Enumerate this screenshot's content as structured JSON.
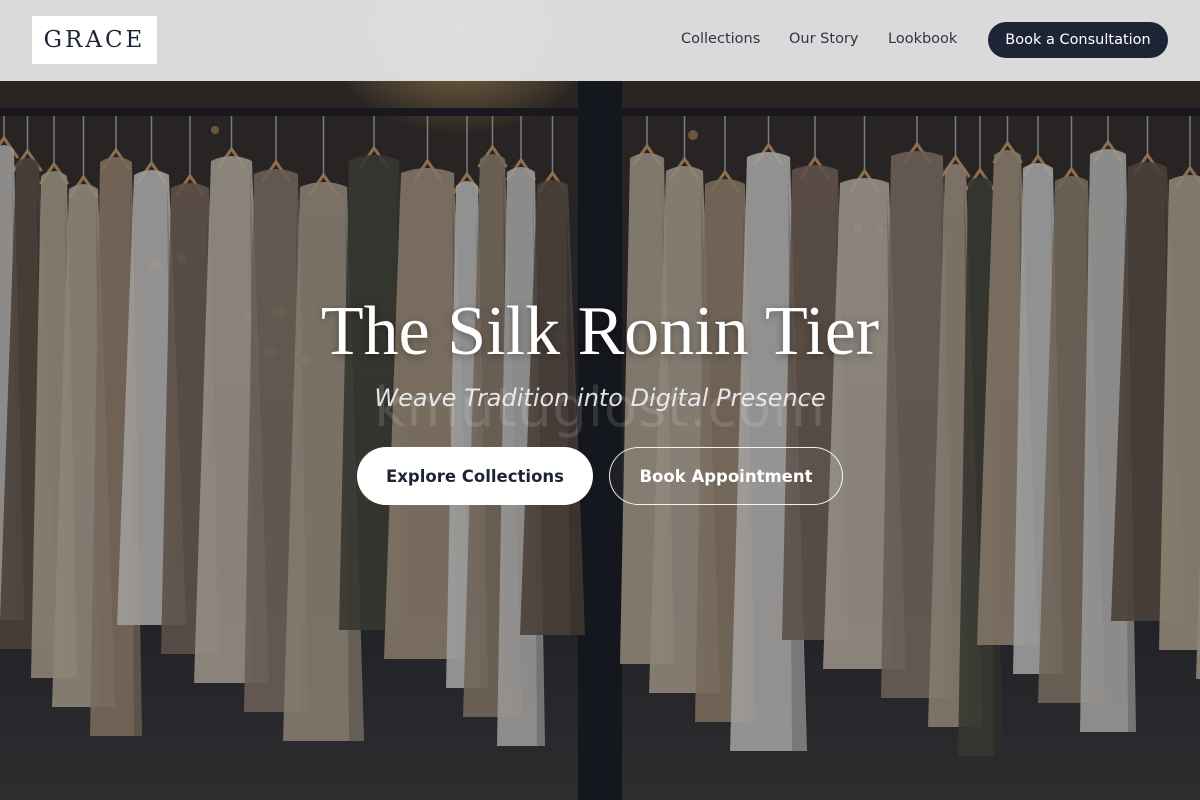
{
  "header": {
    "logo": "GRACE",
    "nav": {
      "collections": "Collections",
      "our_story": "Our Story",
      "lookbook": "Lookbook"
    },
    "cta_label": "Book a Consultation"
  },
  "hero": {
    "title": "The Silk Ronin Tier",
    "subtitle": "Weave Tradition into Digital Presence",
    "watermark": "kmutuglost.com",
    "primary_button": "Explore Collections",
    "secondary_button": "Book Appointment",
    "background_image": "clothing-rack-photo"
  },
  "colors": {
    "navy": "#1d2436",
    "header_bg": "#e2e2e2",
    "white": "#ffffff"
  }
}
